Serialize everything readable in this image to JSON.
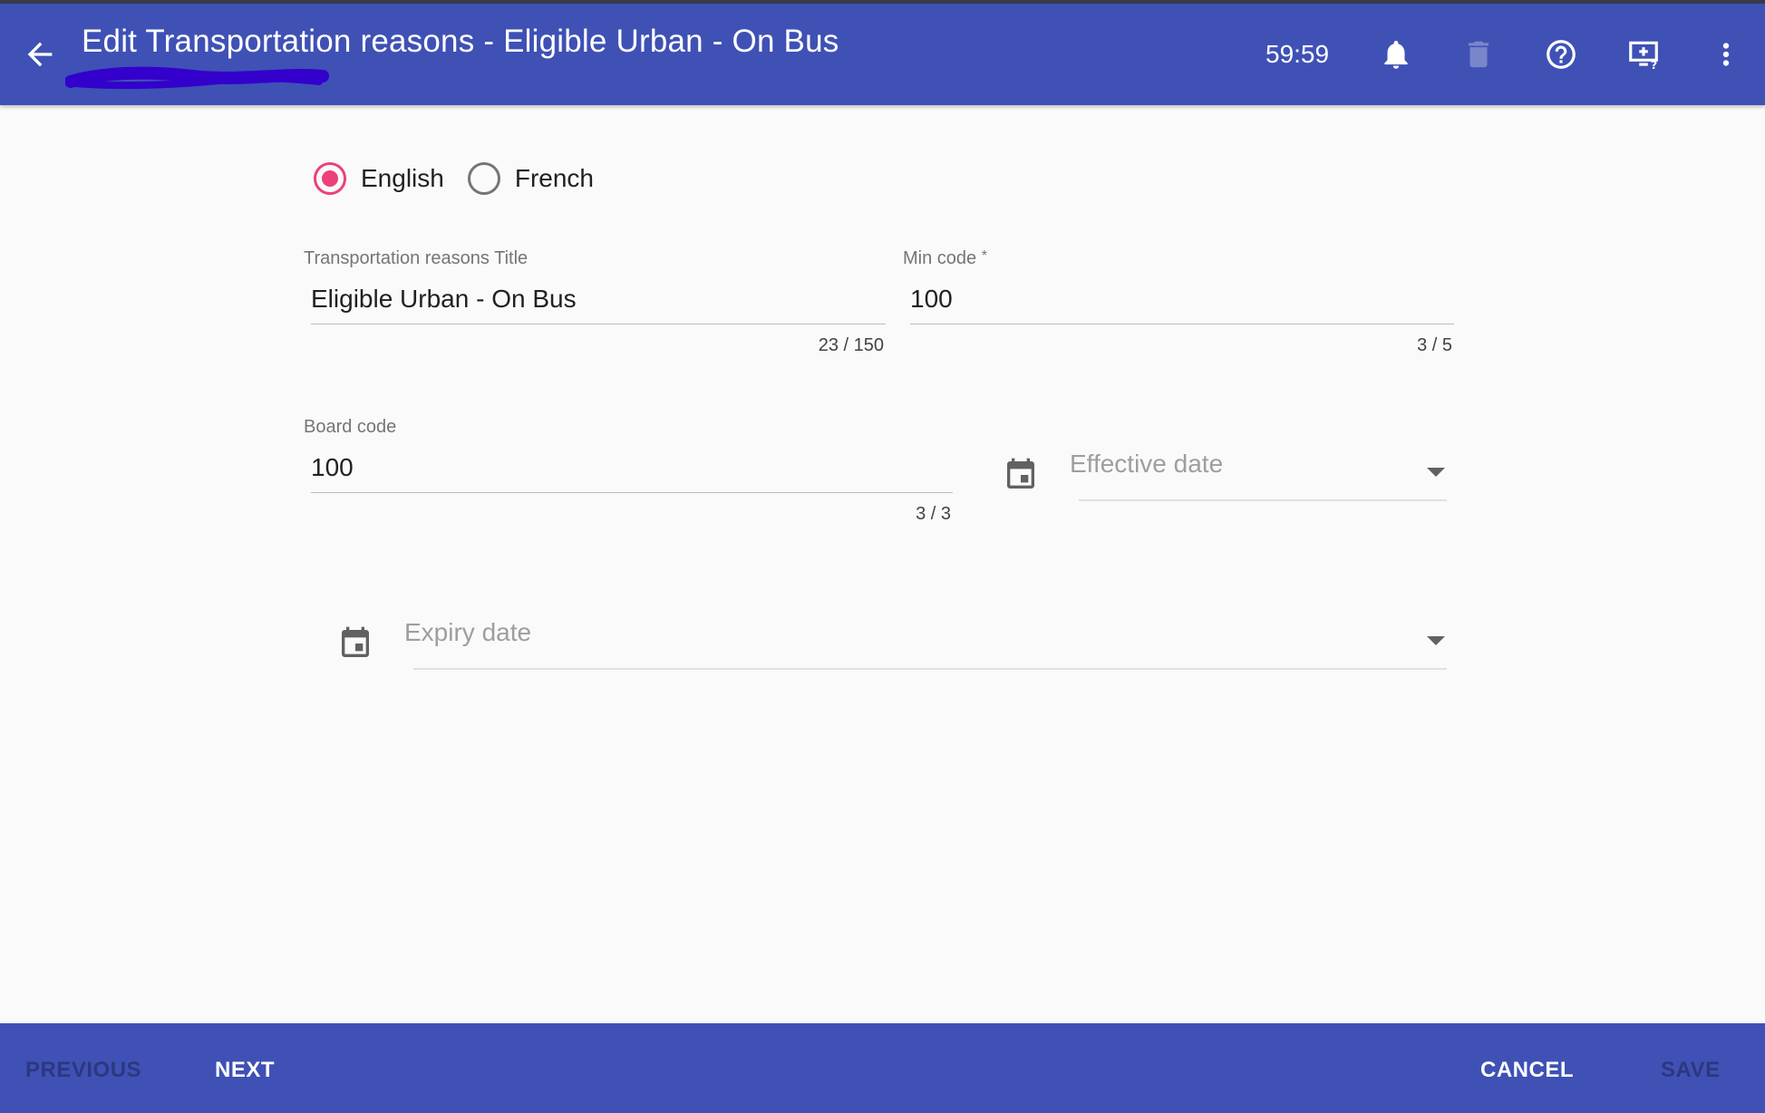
{
  "appbar": {
    "title": "Edit Transportation reasons - Eligible Urban - On Bus",
    "timer": "59:59",
    "icons": [
      "back-arrow-icon",
      "bell-icon",
      "trash-icon",
      "help-circle-icon",
      "add-screen-help-icon",
      "more-vert-icon"
    ]
  },
  "language": {
    "options": [
      {
        "label": "English",
        "selected": true
      },
      {
        "label": "French",
        "selected": false
      }
    ]
  },
  "form": {
    "title_field": {
      "label": "Transportation reasons Title",
      "value": "Eligible Urban - On Bus",
      "counter": "23 / 150"
    },
    "min_code": {
      "label": "Min code",
      "required_mark": "*",
      "value": "100",
      "counter": "3 / 5"
    },
    "board_code": {
      "label": "Board code",
      "value": "100",
      "counter": "3 / 3"
    },
    "effective_date": {
      "placeholder": "Effective date"
    },
    "expiry_date": {
      "placeholder": "Expiry date"
    }
  },
  "footer": {
    "previous": "PREVIOUS",
    "next": "NEXT",
    "cancel": "CANCEL",
    "save": "SAVE"
  },
  "colors": {
    "primary": "#3f51b5",
    "accent": "#ec407a",
    "annotation": "#3300cc"
  }
}
